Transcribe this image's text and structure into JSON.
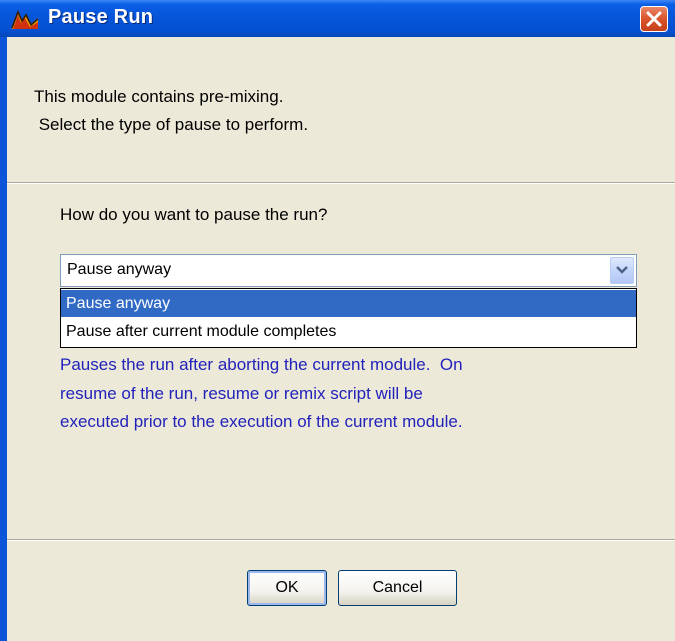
{
  "window": {
    "title": "Pause Run",
    "icons": {
      "app": "app-logo-icon",
      "close": "close-icon"
    }
  },
  "message": {
    "line1": "This module contains pre-mixing.",
    "line2": " Select the type of pause to perform."
  },
  "question": "How do you want to pause the run?",
  "combo": {
    "selected": "Pause anyway",
    "options": [
      "Pause anyway",
      "Pause after current module completes"
    ],
    "icon": "chevron-down-icon"
  },
  "description": {
    "line1": "Pauses the run after aborting the current module.  On",
    "line2": "resume of the run, resume or remix script will be",
    "line3": "executed prior to the execution of the current module."
  },
  "buttons": {
    "ok": "OK",
    "cancel": "Cancel"
  },
  "colors": {
    "titlebar": "#0654d8",
    "dialog_bg": "#ece9d8",
    "selection": "#316ac5",
    "description_text": "#2222bb",
    "close_button": "#d9532c"
  }
}
